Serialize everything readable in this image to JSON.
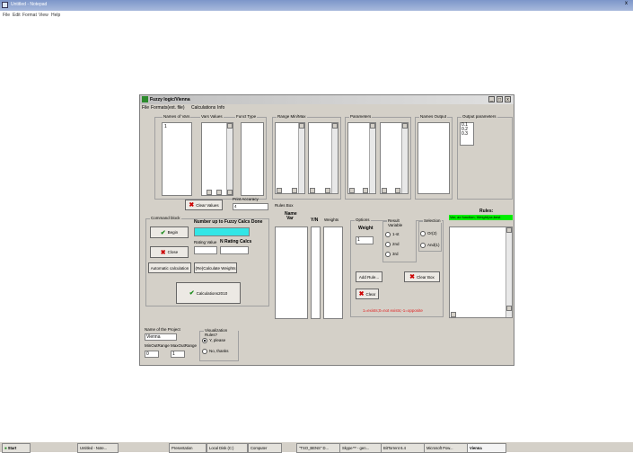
{
  "notepad": {
    "title": "Untitled - Notepad",
    "close": "x",
    "menu": [
      "File",
      "Edit",
      "Format",
      "View",
      "Help"
    ]
  },
  "window": {
    "title": "Fuzzy logic/Vienna",
    "minimize": "_",
    "maximize": "□",
    "close": "x",
    "menu": [
      "File",
      "Formats(ext. file)",
      "Calculations",
      "Info"
    ]
  },
  "vars": {
    "names_label": "Names of Vars",
    "values_label": "Vars Values",
    "funct_label": "Funct Type",
    "names_items": [
      "1"
    ]
  },
  "ranges": {
    "label": "Range Min/Max"
  },
  "parameters": {
    "label": "Parameters"
  },
  "names_output": {
    "label": "Names Output"
  },
  "output_params": {
    "label": "Output parameters",
    "items": [
      "0.1",
      "0.2",
      "0.3"
    ]
  },
  "clear_values": "Clear Values",
  "print_accuracy": {
    "label": "Print Accuracy",
    "value": "4"
  },
  "rules_box": {
    "label": "Rules Box",
    "name_var": "Name Var",
    "yn": "Y/N",
    "weights": "Weights"
  },
  "command": {
    "label": "Command block",
    "begin": "Begin",
    "close": "Close",
    "number_label": "Number up to Fuzzy Calcs Done",
    "rating_value": "Rating Value",
    "n_rating": "N Rating Calcs",
    "auto_calc": "Automatic calculation",
    "recalc_weights": "(Re)Calculate Weights",
    "calculations": "Calculations2010"
  },
  "options": {
    "label": "Options",
    "weight": "Weight",
    "weight_value": "1",
    "result_variable": "Result Variable",
    "result_items": [
      "1-st",
      "2nd",
      "3rd"
    ],
    "selection": "Selection",
    "selection_items": [
      "Or(2)",
      "And(1)"
    ],
    "add_rule": "Add Rule...",
    "clear_box": "Clear Box",
    "clear": "Clear",
    "hint": "1=exists;0=not exists;-1=opposite"
  },
  "rules": {
    "label": "Rules:",
    "sub": "Var;  ax function; Weight(ax;best"
  },
  "project": {
    "name_label": "Name of the Project",
    "name_value": "Vienna",
    "min_label": "MinOutRange",
    "max_label": "MaxOutRange",
    "min_value": "0",
    "max_value": "1",
    "vis_label": "Visualization Rules?",
    "vis_yes": "Y, please",
    "vis_no": "No, thanks"
  },
  "taskbar": {
    "start": "Start",
    "items": [
      "Untitled - Note...",
      "Presentation",
      "Local Disk (C:)",
      "Computer",
      "\"TSO_BENS\" D...",
      "Skype™ - gen...",
      "BitTorrent 6.4",
      "Microsoft Pow...",
      "Vienna"
    ]
  },
  "colors": {
    "cyan_field": "#33e6e6",
    "rules_header": "#00ee00",
    "hint_red": "#e02020",
    "begin_check": "#1a8a1a",
    "close_x": "#cc0000"
  }
}
